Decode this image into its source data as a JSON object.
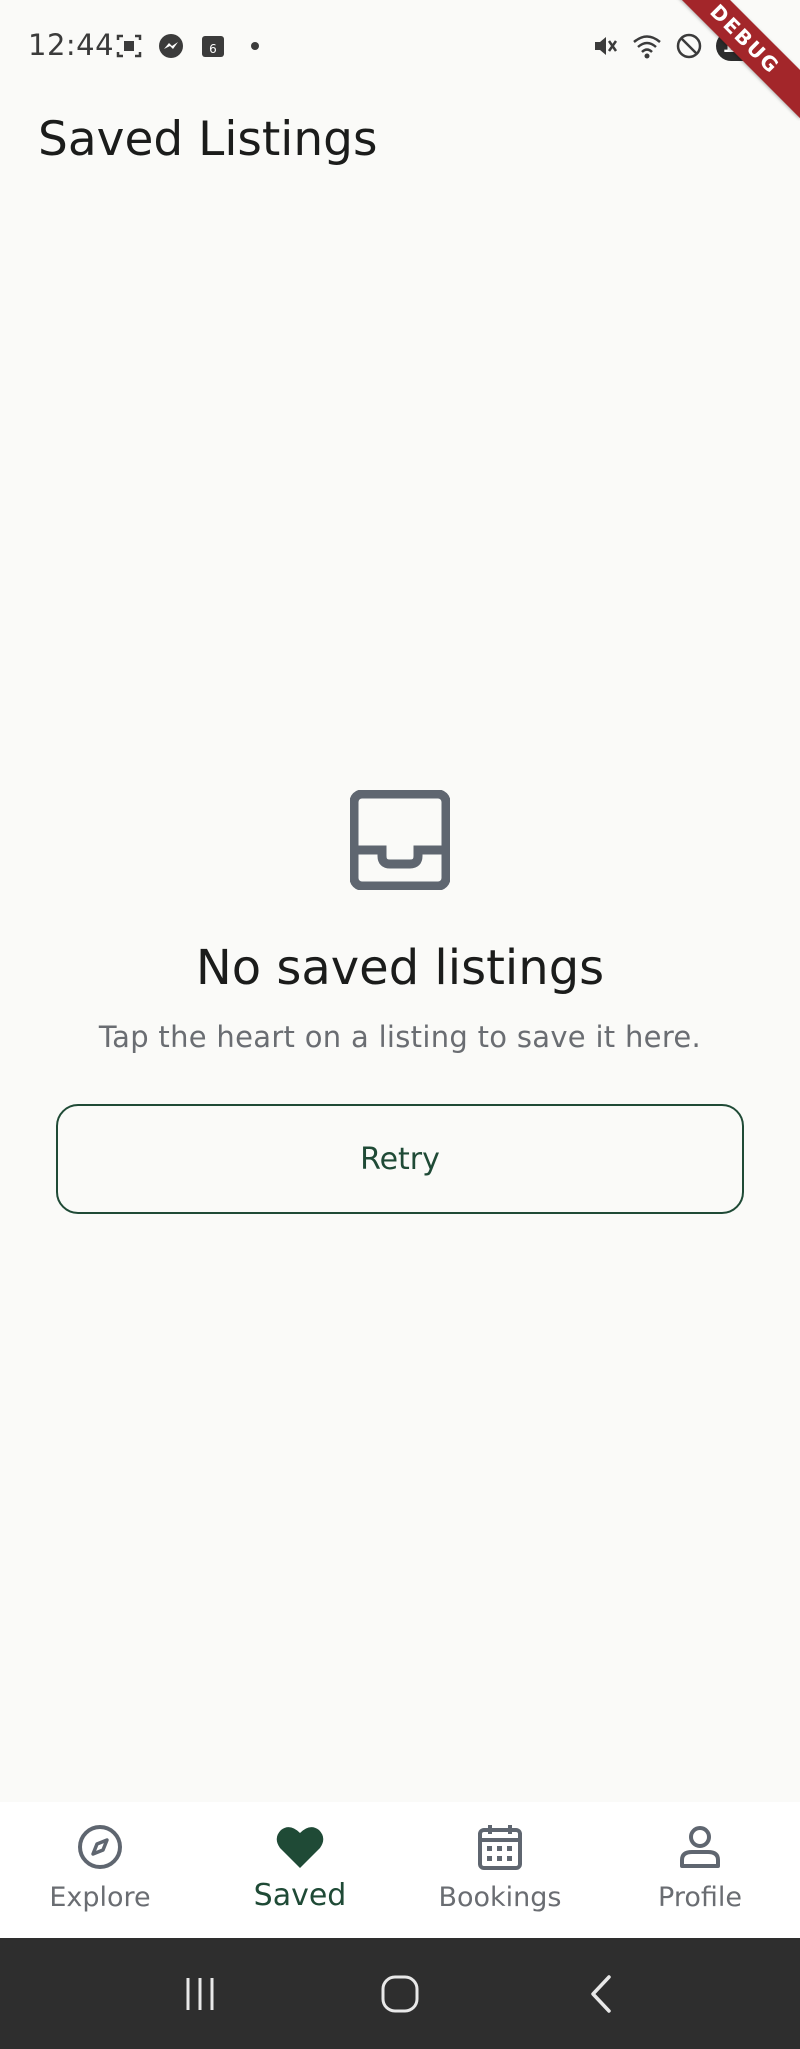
{
  "status_bar": {
    "time": "12:44",
    "battery": "100",
    "icons": [
      "screenshot-icon",
      "messenger-icon",
      "calendar-icon",
      "dot-icon",
      "mute-icon",
      "wifi-icon",
      "dnd-icon",
      "battery-icon"
    ]
  },
  "debug_banner": "DEBUG",
  "app_bar": {
    "title": "Saved Listings"
  },
  "empty_state": {
    "icon": "inbox-icon",
    "title": "No saved listings",
    "subtitle": "Tap the heart on a listing to save it here.",
    "retry_label": "Retry"
  },
  "bottom_nav": {
    "items": [
      {
        "label": "Explore",
        "icon": "compass-icon",
        "active": false
      },
      {
        "label": "Saved",
        "icon": "heart-icon",
        "active": true
      },
      {
        "label": "Bookings",
        "icon": "calendar-icon",
        "active": false
      },
      {
        "label": "Profile",
        "icon": "person-icon",
        "active": false
      }
    ]
  },
  "colors": {
    "background": "#fafaf8",
    "accent": "#1f4a36",
    "muted": "#6a6d72",
    "icon_gray": "#5f6670",
    "debug_red": "#a3262a"
  }
}
